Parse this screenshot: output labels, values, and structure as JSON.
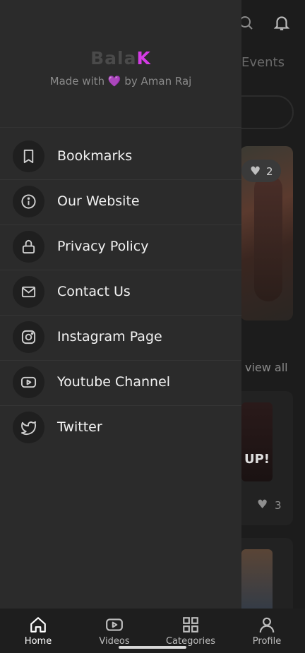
{
  "background": {
    "tab_partial": "Events",
    "like_count_1": "2",
    "view_all": "view all",
    "poster_text": "UP!",
    "like_count_2": "3"
  },
  "drawer": {
    "brand_prefix": "Bala",
    "brand_suffix": "K",
    "tagline_before": "Made with ",
    "tagline_heart": "💜",
    "tagline_after": " by Aman Raj",
    "items": [
      {
        "label": "Bookmarks",
        "icon": "bookmark-icon"
      },
      {
        "label": "Our Website",
        "icon": "info-icon"
      },
      {
        "label": "Privacy Policy",
        "icon": "lock-icon"
      },
      {
        "label": "Contact Us",
        "icon": "mail-icon"
      },
      {
        "label": "Instagram Page",
        "icon": "instagram-icon"
      },
      {
        "label": "Youtube Channel",
        "icon": "youtube-icon"
      },
      {
        "label": "Twitter",
        "icon": "twitter-icon"
      }
    ]
  },
  "bottom_nav": {
    "items": [
      {
        "label": "Home",
        "icon": "home-icon",
        "active": true
      },
      {
        "label": "Videos",
        "icon": "video-icon",
        "active": false
      },
      {
        "label": "Categories",
        "icon": "grid-icon",
        "active": false
      },
      {
        "label": "Profile",
        "icon": "user-icon",
        "active": false
      }
    ]
  },
  "colors": {
    "drawer_bg": "#2b2b2b",
    "brand_accent": "#d43be5",
    "background": "#1c1c1c"
  }
}
